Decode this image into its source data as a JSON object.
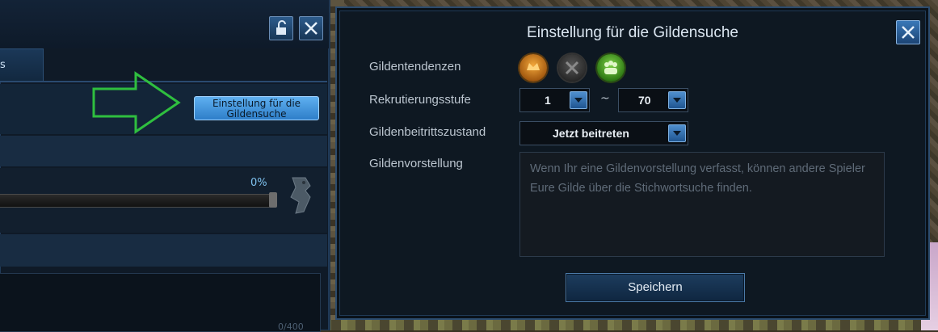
{
  "left_panel": {
    "tab_label": "s",
    "guild_search_settings_button": "Einstellung für die\nGildensuche",
    "progress_percent_text": "0%",
    "progress_value": 0,
    "text_counter": "0/400"
  },
  "dialog": {
    "title": "Einstellung für die Gildensuche",
    "labels": {
      "tendencies": "Gildentendenzen",
      "recruit_level": "Rekrutierungsstufe",
      "join_state": "Gildenbeitrittszustand",
      "introduction": "Gildenvorstellung"
    },
    "recruit_level_min": "1",
    "recruit_level_sep": "~",
    "recruit_level_max": "70",
    "join_state_value": "Jetzt beitreten",
    "introduction_placeholder": "Wenn Ihr eine Gildenvorstellung verfasst, können andere Spieler Eure Gilde über die Stichwortsuche finden.",
    "save_button": "Speichern",
    "tendency_icons": [
      "pve-icon",
      "pvp-icon",
      "social-icon"
    ]
  },
  "colors": {
    "accent_blue": "#2e7ec9",
    "arrow_green": "#2fbf3f",
    "progress_text": "#7fc2ef"
  }
}
